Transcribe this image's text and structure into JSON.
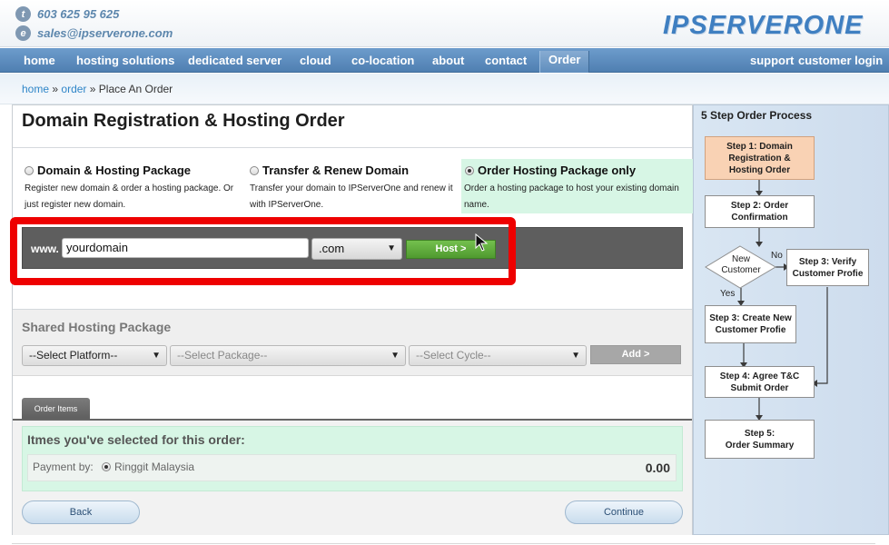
{
  "header": {
    "phone": "603 625 95 625",
    "phone_icon": "t",
    "email": "sales@ipserverone.com",
    "email_icon": "e",
    "logo_text": "IPSERVERONE"
  },
  "nav": {
    "items": [
      "home",
      "hosting solutions",
      "dedicated server",
      "cloud",
      "co-location",
      "about",
      "contact",
      "Order"
    ],
    "support": "support",
    "customer_login": "customer login"
  },
  "breadcrumb": {
    "home": "home",
    "sep1": "»",
    "order": "order",
    "sep2": "»",
    "current": "Place An Order"
  },
  "page": {
    "title": "Domain Registration & Hosting Order"
  },
  "options": [
    {
      "title": "Domain & Hosting Package",
      "desc1": "Register new domain & order a hosting package. Or",
      "desc2": "just register new domain.",
      "selected": false
    },
    {
      "title": "Transfer & Renew Domain",
      "desc1": "Transfer your domain to IPServerOne and renew it",
      "desc2": "with IPServerOne.",
      "selected": false
    },
    {
      "title": "Order Hosting Package only",
      "desc1": "Order a hosting package to host your existing domain",
      "desc2": "name.",
      "selected": true
    }
  ],
  "domain": {
    "prefix": "www.",
    "value": "yourdomain",
    "tld": ".com",
    "host_button": "Host >"
  },
  "shared": {
    "title": "Shared Hosting Package",
    "platform": "--Select Platform--",
    "package": "--Select Package--",
    "cycle": "--Select Cycle--",
    "add_button": "Add >"
  },
  "order_items": {
    "tab": "Order Items",
    "title": "Itmes you've selected for this order:",
    "payment_label": "Payment by:",
    "payment_method": "Ringgit Malaysia",
    "total": "0.00"
  },
  "buttons": {
    "back": "Back",
    "continue": "Continue"
  },
  "sidebar": {
    "title": "5 Step Order Process",
    "step1a": "Step 1: Domain",
    "step1b": "Registration &",
    "step1c": "Hosting Order",
    "step2a": "Step 2: Order",
    "step2b": "Confirmation",
    "decision_a": "New",
    "decision_b": "Customer",
    "no": "No",
    "yes": "Yes",
    "step3_verify_a": "Step 3: Verify",
    "step3_verify_b": "Customer Profie",
    "step3_create_a": "Step 3: Create New",
    "step3_create_b": "Customer Profie",
    "step4a": "Step 4: Agree T&C",
    "step4b": "Submit Order",
    "step5a": "Step 5:",
    "step5b": "Order Summary"
  },
  "colors": {
    "nav": "#5f8dbd",
    "selected_option": "#d7f6e5",
    "highlight": "#ee0000",
    "host_button": "#5aa835"
  }
}
